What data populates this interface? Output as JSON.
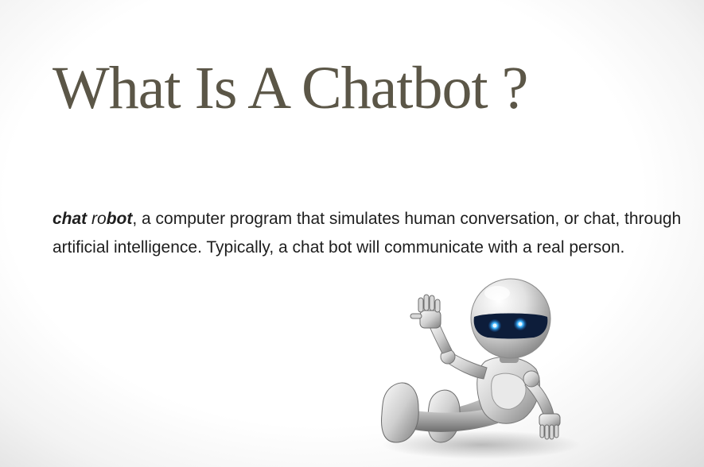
{
  "slide": {
    "title": "What Is A Chatbot ?",
    "definition": {
      "term_part1": "chat",
      "term_part2_light": "ro",
      "term_part2_bold": "bot",
      "body": ", a computer program that simulates human conversation, or chat, through artificial intelligence. Typically, a chat bot will communicate with a real person."
    },
    "illustration": {
      "icon": "robot-icon"
    }
  },
  "colors": {
    "title": "#5b5647",
    "body_text": "#1e1e1e",
    "robot_visor": "#0d1d3a",
    "robot_eyes": "#3fb6ff"
  }
}
